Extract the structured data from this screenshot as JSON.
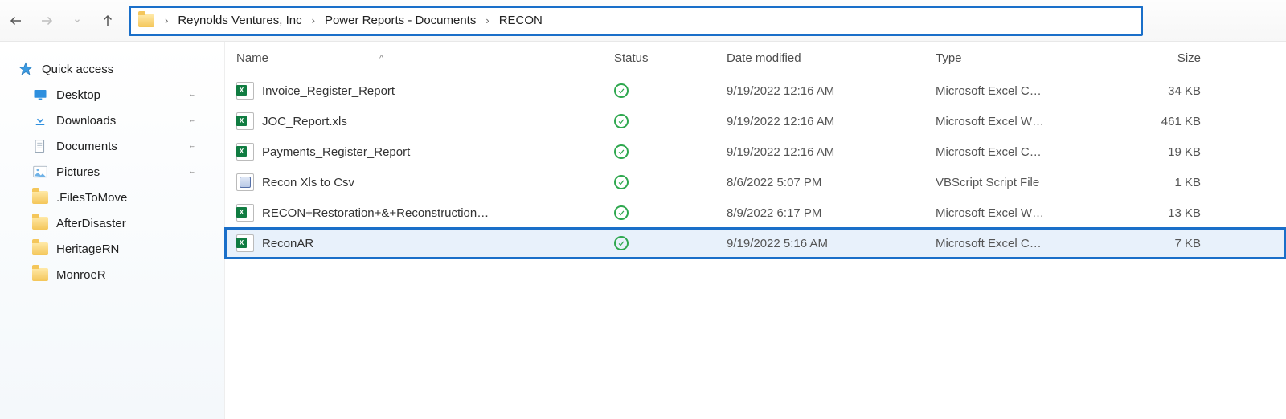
{
  "breadcrumb": {
    "items": [
      "Reynolds Ventures, Inc",
      "Power Reports - Documents",
      "RECON"
    ]
  },
  "columns": {
    "name": "Name",
    "status": "Status",
    "date": "Date modified",
    "type": "Type",
    "size": "Size"
  },
  "sidebar": {
    "quickaccess": "Quick access",
    "items": [
      {
        "label": "Desktop",
        "icon": "desktop",
        "pinned": true
      },
      {
        "label": "Downloads",
        "icon": "downloads",
        "pinned": true
      },
      {
        "label": "Documents",
        "icon": "documents",
        "pinned": true
      },
      {
        "label": "Pictures",
        "icon": "pictures",
        "pinned": true
      },
      {
        "label": ".FilesToMove",
        "icon": "folder",
        "pinned": false
      },
      {
        "label": "AfterDisaster",
        "icon": "folder",
        "pinned": false
      },
      {
        "label": "HeritageRN",
        "icon": "folder",
        "pinned": false
      },
      {
        "label": "MonroeR",
        "icon": "folder",
        "pinned": false
      }
    ]
  },
  "files": [
    {
      "name": "Invoice_Register_Report",
      "icon": "excel",
      "status": "synced",
      "date": "9/19/2022 12:16 AM",
      "type": "Microsoft Excel C…",
      "size": "34 KB",
      "selected": false
    },
    {
      "name": "JOC_Report.xls",
      "icon": "excel",
      "status": "synced",
      "date": "9/19/2022 12:16 AM",
      "type": "Microsoft Excel W…",
      "size": "461 KB",
      "selected": false
    },
    {
      "name": "Payments_Register_Report",
      "icon": "excel",
      "status": "synced",
      "date": "9/19/2022 12:16 AM",
      "type": "Microsoft Excel C…",
      "size": "19 KB",
      "selected": false
    },
    {
      "name": "Recon Xls to Csv",
      "icon": "vbs",
      "status": "synced",
      "date": "8/6/2022 5:07 PM",
      "type": "VBScript Script File",
      "size": "1 KB",
      "selected": false
    },
    {
      "name": "RECON+Restoration+&+Reconstruction…",
      "icon": "excel",
      "status": "synced",
      "date": "8/9/2022 6:17 PM",
      "type": "Microsoft Excel W…",
      "size": "13 KB",
      "selected": false
    },
    {
      "name": "ReconAR",
      "icon": "excel",
      "status": "synced",
      "date": "9/19/2022 5:16 AM",
      "type": "Microsoft Excel C…",
      "size": "7 KB",
      "selected": true
    }
  ]
}
